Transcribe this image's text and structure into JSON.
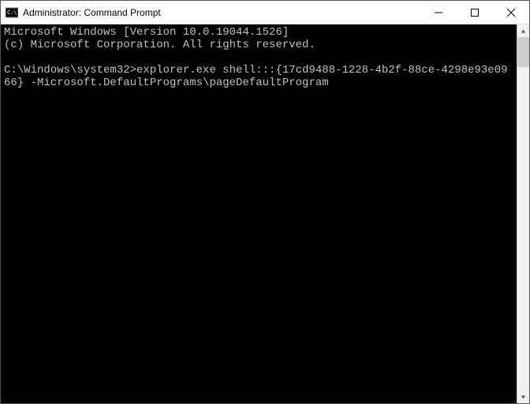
{
  "window": {
    "title": "Administrator: Command Prompt"
  },
  "terminal": {
    "line1": "Microsoft Windows [Version 10.0.19044.1526]",
    "line2": "(c) Microsoft Corporation. All rights reserved.",
    "blank": "",
    "prompt": "C:\\Windows\\system32>",
    "command": "explorer.exe shell:::{17cd9488-1228-4b2f-88ce-4298e93e0966} -Microsoft.DefaultPrograms\\pageDefaultProgram"
  }
}
